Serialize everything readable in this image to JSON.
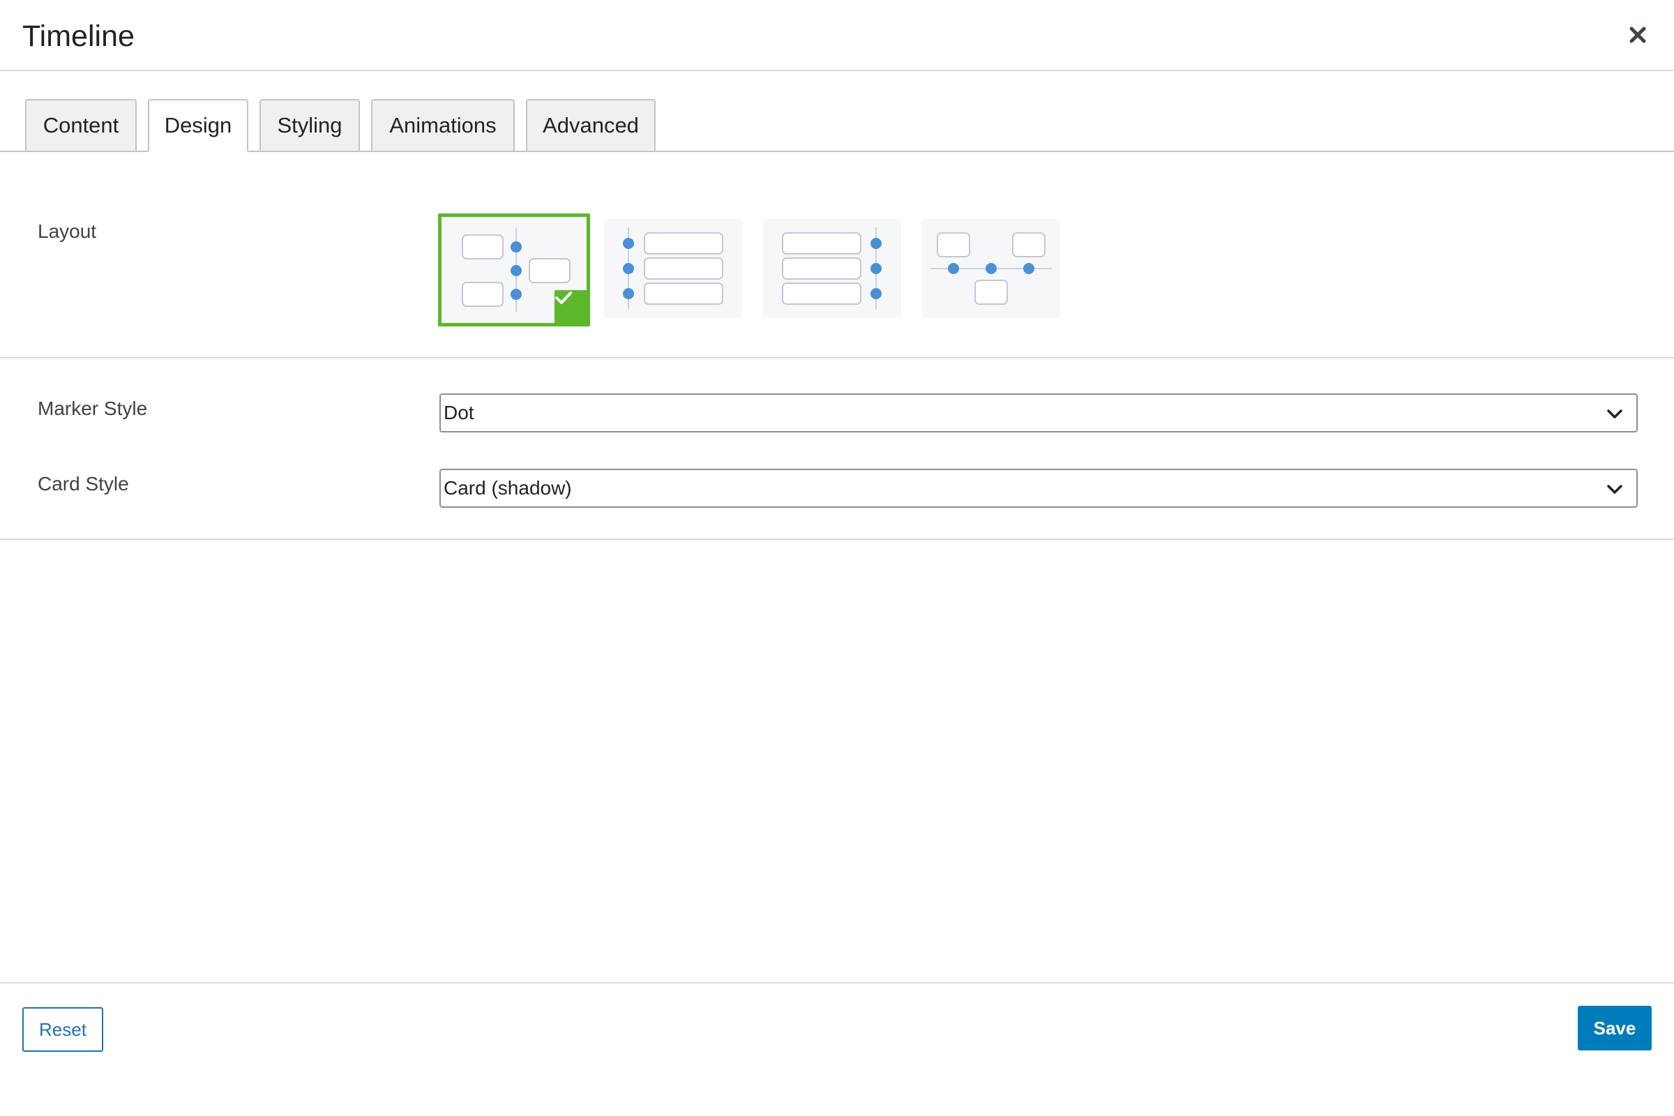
{
  "dialog": {
    "title": "Timeline",
    "close_icon": "close-icon"
  },
  "tabs": [
    {
      "label": "Content",
      "active": false
    },
    {
      "label": "Design",
      "active": true
    },
    {
      "label": "Styling",
      "active": false
    },
    {
      "label": "Animations",
      "active": false
    },
    {
      "label": "Advanced",
      "active": false
    }
  ],
  "layout": {
    "label": "Layout",
    "options": [
      {
        "name": "alternating-vertical",
        "selected": true
      },
      {
        "name": "left-aligned-vertical",
        "selected": false
      },
      {
        "name": "right-aligned-vertical",
        "selected": false
      },
      {
        "name": "horizontal",
        "selected": false
      }
    ]
  },
  "marker_style": {
    "label": "Marker Style",
    "value": "Dot"
  },
  "card_style": {
    "label": "Card Style",
    "value": "Card (shadow)"
  },
  "footer": {
    "reset_label": "Reset",
    "save_label": "Save"
  },
  "colors": {
    "accent_blue": "#007cba",
    "selected_green": "#5cb82a",
    "marker_dot": "#4a90d9"
  }
}
